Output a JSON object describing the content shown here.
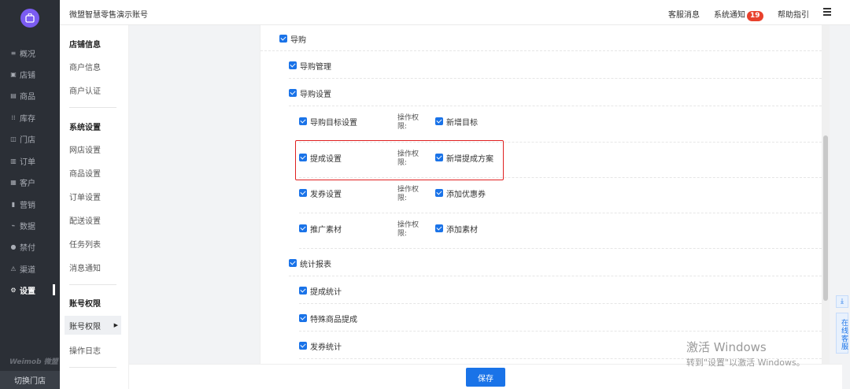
{
  "nav": {
    "items": [
      {
        "icon": "≡",
        "label": "概况"
      },
      {
        "icon": "▣",
        "label": "店铺"
      },
      {
        "icon": "▤",
        "label": "商品"
      },
      {
        "icon": "⁞⁞",
        "label": "库存"
      },
      {
        "icon": "◫",
        "label": "门店"
      },
      {
        "icon": "▥",
        "label": "订单"
      },
      {
        "icon": "▦",
        "label": "客户"
      },
      {
        "icon": "▮",
        "label": "营销"
      },
      {
        "icon": "⌁",
        "label": "数据"
      },
      {
        "icon": "●",
        "label": "禁付"
      },
      {
        "icon": "⚠",
        "label": "渠道"
      },
      {
        "icon": "⚙",
        "label": "设置"
      }
    ],
    "brand": "Weimob 微盟",
    "switch_store": "切换门店"
  },
  "header": {
    "account": "微盟智慧零售演示账号",
    "service_msg": "客服消息",
    "sys_notice": "系统通知",
    "notice_count": "19",
    "help": "帮助指引"
  },
  "subnav": {
    "groups": [
      {
        "title": "店铺信息",
        "items": [
          "商户信息",
          "商户认证"
        ]
      },
      {
        "title": "系统设置",
        "items": [
          "网店设置",
          "商品设置",
          "订单设置",
          "配送设置",
          "任务列表",
          "消息通知"
        ]
      },
      {
        "title": "账号权限",
        "items": [
          "账号权限",
          "操作日志"
        ]
      }
    ]
  },
  "perm": {
    "root": "导购",
    "guide_mgmt": "导购管理",
    "guide_settings": "导购设置",
    "perm_label": "操作权限:",
    "rows": [
      {
        "name": "导购目标设置",
        "action": "新增目标"
      },
      {
        "name": "提成设置",
        "action": "新增提成方案"
      },
      {
        "name": "发券设置",
        "action": "添加优惠券"
      },
      {
        "name": "推广素材",
        "action": "添加素材"
      }
    ],
    "stats": "统计报表",
    "stats_items": [
      "提成统计",
      "特殊商品提成",
      "发券统计"
    ]
  },
  "footer": {
    "save": "保存"
  },
  "float": {
    "download": "⤓",
    "service": "在线客服"
  },
  "watermark": {
    "line1": "激活 Windows",
    "line2": "转到\"设置\"以激活 Windows。"
  },
  "colors": {
    "accent": "#1a73e8",
    "nav_bg": "#2b2f36",
    "highlight": "#e02020",
    "badge": "#e8412c"
  }
}
